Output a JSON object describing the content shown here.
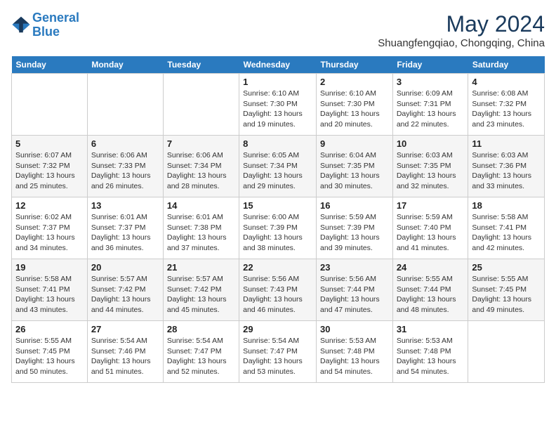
{
  "logo": {
    "line1": "General",
    "line2": "Blue"
  },
  "title": "May 2024",
  "location": "Shuangfengqiao, Chongqing, China",
  "days_of_week": [
    "Sunday",
    "Monday",
    "Tuesday",
    "Wednesday",
    "Thursday",
    "Friday",
    "Saturday"
  ],
  "weeks": [
    [
      {
        "day": "",
        "info": ""
      },
      {
        "day": "",
        "info": ""
      },
      {
        "day": "",
        "info": ""
      },
      {
        "day": "1",
        "info": "Sunrise: 6:10 AM\nSunset: 7:30 PM\nDaylight: 13 hours and 19 minutes."
      },
      {
        "day": "2",
        "info": "Sunrise: 6:10 AM\nSunset: 7:30 PM\nDaylight: 13 hours and 20 minutes."
      },
      {
        "day": "3",
        "info": "Sunrise: 6:09 AM\nSunset: 7:31 PM\nDaylight: 13 hours and 22 minutes."
      },
      {
        "day": "4",
        "info": "Sunrise: 6:08 AM\nSunset: 7:32 PM\nDaylight: 13 hours and 23 minutes."
      }
    ],
    [
      {
        "day": "5",
        "info": "Sunrise: 6:07 AM\nSunset: 7:32 PM\nDaylight: 13 hours and 25 minutes."
      },
      {
        "day": "6",
        "info": "Sunrise: 6:06 AM\nSunset: 7:33 PM\nDaylight: 13 hours and 26 minutes."
      },
      {
        "day": "7",
        "info": "Sunrise: 6:06 AM\nSunset: 7:34 PM\nDaylight: 13 hours and 28 minutes."
      },
      {
        "day": "8",
        "info": "Sunrise: 6:05 AM\nSunset: 7:34 PM\nDaylight: 13 hours and 29 minutes."
      },
      {
        "day": "9",
        "info": "Sunrise: 6:04 AM\nSunset: 7:35 PM\nDaylight: 13 hours and 30 minutes."
      },
      {
        "day": "10",
        "info": "Sunrise: 6:03 AM\nSunset: 7:35 PM\nDaylight: 13 hours and 32 minutes."
      },
      {
        "day": "11",
        "info": "Sunrise: 6:03 AM\nSunset: 7:36 PM\nDaylight: 13 hours and 33 minutes."
      }
    ],
    [
      {
        "day": "12",
        "info": "Sunrise: 6:02 AM\nSunset: 7:37 PM\nDaylight: 13 hours and 34 minutes."
      },
      {
        "day": "13",
        "info": "Sunrise: 6:01 AM\nSunset: 7:37 PM\nDaylight: 13 hours and 36 minutes."
      },
      {
        "day": "14",
        "info": "Sunrise: 6:01 AM\nSunset: 7:38 PM\nDaylight: 13 hours and 37 minutes."
      },
      {
        "day": "15",
        "info": "Sunrise: 6:00 AM\nSunset: 7:39 PM\nDaylight: 13 hours and 38 minutes."
      },
      {
        "day": "16",
        "info": "Sunrise: 5:59 AM\nSunset: 7:39 PM\nDaylight: 13 hours and 39 minutes."
      },
      {
        "day": "17",
        "info": "Sunrise: 5:59 AM\nSunset: 7:40 PM\nDaylight: 13 hours and 41 minutes."
      },
      {
        "day": "18",
        "info": "Sunrise: 5:58 AM\nSunset: 7:41 PM\nDaylight: 13 hours and 42 minutes."
      }
    ],
    [
      {
        "day": "19",
        "info": "Sunrise: 5:58 AM\nSunset: 7:41 PM\nDaylight: 13 hours and 43 minutes."
      },
      {
        "day": "20",
        "info": "Sunrise: 5:57 AM\nSunset: 7:42 PM\nDaylight: 13 hours and 44 minutes."
      },
      {
        "day": "21",
        "info": "Sunrise: 5:57 AM\nSunset: 7:42 PM\nDaylight: 13 hours and 45 minutes."
      },
      {
        "day": "22",
        "info": "Sunrise: 5:56 AM\nSunset: 7:43 PM\nDaylight: 13 hours and 46 minutes."
      },
      {
        "day": "23",
        "info": "Sunrise: 5:56 AM\nSunset: 7:44 PM\nDaylight: 13 hours and 47 minutes."
      },
      {
        "day": "24",
        "info": "Sunrise: 5:55 AM\nSunset: 7:44 PM\nDaylight: 13 hours and 48 minutes."
      },
      {
        "day": "25",
        "info": "Sunrise: 5:55 AM\nSunset: 7:45 PM\nDaylight: 13 hours and 49 minutes."
      }
    ],
    [
      {
        "day": "26",
        "info": "Sunrise: 5:55 AM\nSunset: 7:45 PM\nDaylight: 13 hours and 50 minutes."
      },
      {
        "day": "27",
        "info": "Sunrise: 5:54 AM\nSunset: 7:46 PM\nDaylight: 13 hours and 51 minutes."
      },
      {
        "day": "28",
        "info": "Sunrise: 5:54 AM\nSunset: 7:47 PM\nDaylight: 13 hours and 52 minutes."
      },
      {
        "day": "29",
        "info": "Sunrise: 5:54 AM\nSunset: 7:47 PM\nDaylight: 13 hours and 53 minutes."
      },
      {
        "day": "30",
        "info": "Sunrise: 5:53 AM\nSunset: 7:48 PM\nDaylight: 13 hours and 54 minutes."
      },
      {
        "day": "31",
        "info": "Sunrise: 5:53 AM\nSunset: 7:48 PM\nDaylight: 13 hours and 54 minutes."
      },
      {
        "day": "",
        "info": ""
      }
    ]
  ]
}
